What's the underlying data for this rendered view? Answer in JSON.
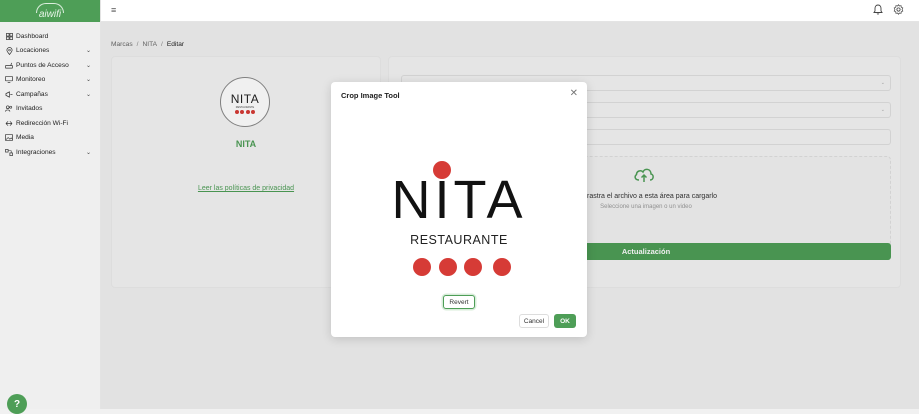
{
  "app": {
    "logo_text": "aiwifi"
  },
  "sidebar": {
    "items": [
      {
        "label": "Dashboard",
        "icon": "grid-icon",
        "chevron": false
      },
      {
        "label": "Locaciones",
        "icon": "location-pin-icon",
        "chevron": true
      },
      {
        "label": "Puntos de Acceso",
        "icon": "access-point-icon",
        "chevron": true
      },
      {
        "label": "Monitoreo",
        "icon": "monitor-icon",
        "chevron": true
      },
      {
        "label": "Campañas",
        "icon": "megaphone-icon",
        "chevron": true
      },
      {
        "label": "Invitados",
        "icon": "guests-icon",
        "chevron": false
      },
      {
        "label": "Redirección Wi-Fi",
        "icon": "redirect-icon",
        "chevron": false
      },
      {
        "label": "Media",
        "icon": "image-icon",
        "chevron": false
      },
      {
        "label": "Integraciones",
        "icon": "integrations-icon",
        "chevron": true
      }
    ]
  },
  "breadcrumb": {
    "items": [
      "Marcas",
      "NITA",
      "Editar"
    ]
  },
  "brand": {
    "name": "NITA",
    "logo_word": "NITA",
    "logo_sub": "RESTAURANTE",
    "privacy_link": "Leer las políticas de privacidad"
  },
  "form": {
    "upload_title": "o arrastra el archivo a esta área para cargarlo",
    "upload_sub": "Seleccione una imagen o un video",
    "update_label": "Actualización"
  },
  "modal": {
    "title": "Crop Image Tool",
    "revert_label": "Revert",
    "cancel_label": "Cancel",
    "ok_label": "OK"
  },
  "help": {
    "label": "?"
  },
  "colors": {
    "accent": "#4e9e57",
    "logo_red": "#d63b36"
  }
}
